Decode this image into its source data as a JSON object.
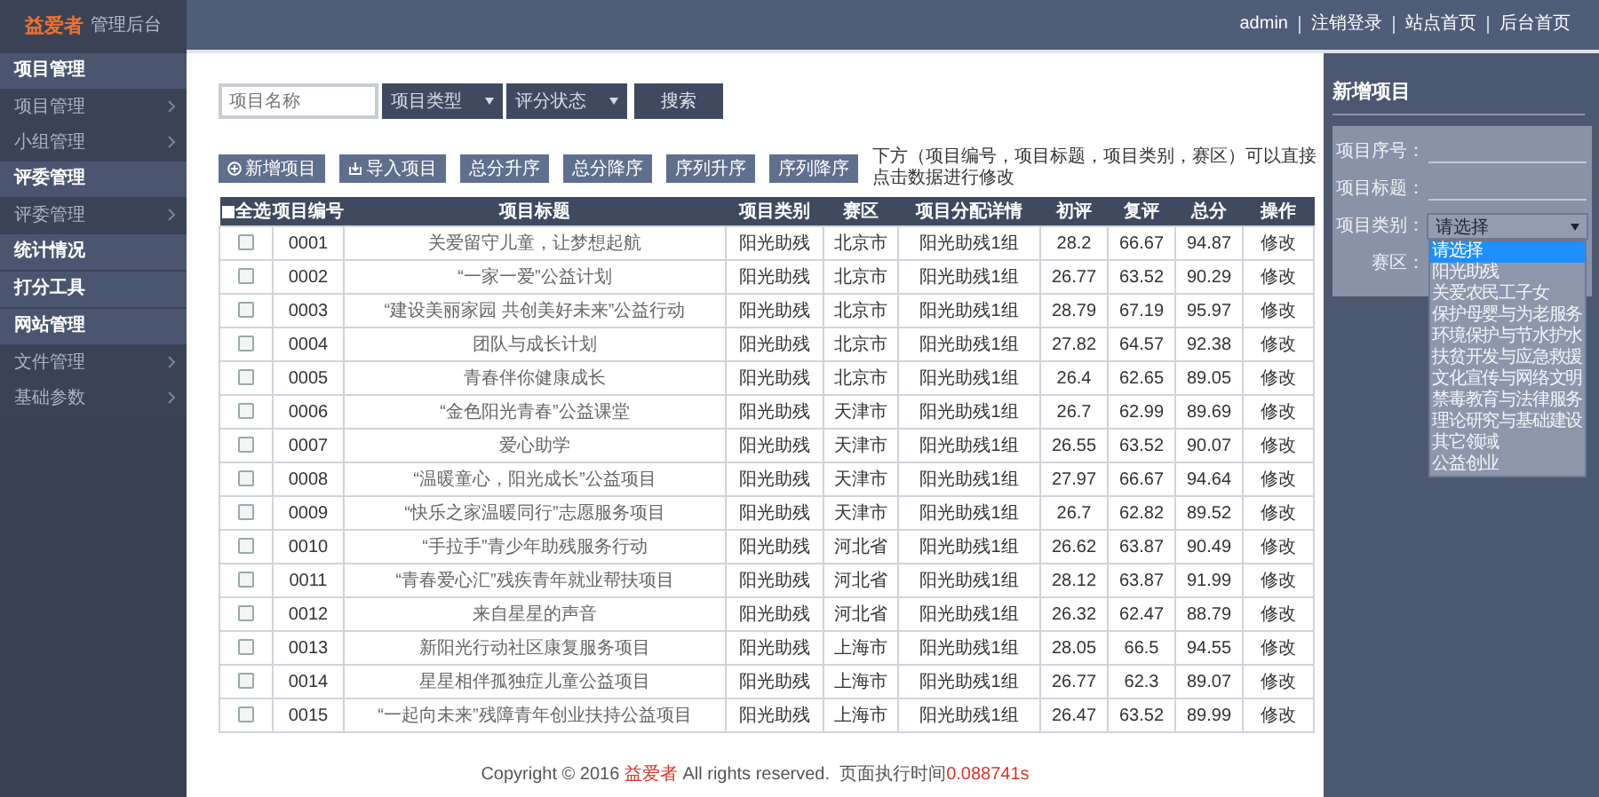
{
  "header": {
    "logo": "益爱者",
    "subtitle": "管理后台",
    "user": "admin",
    "links": [
      "注销登录",
      "站点首页",
      "后台首页"
    ]
  },
  "sidebar": [
    {
      "label": "项目管理",
      "kind": "group"
    },
    {
      "label": "项目管理",
      "kind": "item"
    },
    {
      "label": "小组管理",
      "kind": "item"
    },
    {
      "label": "评委管理",
      "kind": "group"
    },
    {
      "label": "评委管理",
      "kind": "item"
    },
    {
      "label": "统计情况",
      "kind": "group"
    },
    {
      "label": "打分工具",
      "kind": "group"
    },
    {
      "label": "网站管理",
      "kind": "group"
    },
    {
      "label": "文件管理",
      "kind": "item"
    },
    {
      "label": "基础参数",
      "kind": "item"
    }
  ],
  "filters": {
    "name_placeholder": "项目名称",
    "selects": [
      "项目类型",
      "评分状态"
    ],
    "search": "搜索"
  },
  "actions": [
    {
      "label": "新增项目",
      "kind": "add"
    },
    {
      "label": "导入项目",
      "kind": "import"
    },
    {
      "label": "总分升序",
      "kind": "plain"
    },
    {
      "label": "总分降序",
      "kind": "plain"
    },
    {
      "label": "序列升序",
      "kind": "plain"
    },
    {
      "label": "序列降序",
      "kind": "plain"
    }
  ],
  "note": "下方（项目编号，项目标题，项目类别，赛区）可以直接点击数据进行修改",
  "table": {
    "select_all": {
      "label": "全选",
      "checked": false
    },
    "columns": [
      "项目编号",
      "项目标题",
      "项目类别",
      "赛区",
      "项目分配详情",
      "初评",
      "复评",
      "总分",
      "操作"
    ],
    "rows": [
      {
        "checked": false,
        "cells": [
          "0001",
          "关爱留守儿童，让梦想起航",
          "阳光助残",
          "北京市",
          "阳光助残1组",
          "28.2",
          "66.67",
          "94.87",
          "修改"
        ]
      },
      {
        "checked": false,
        "cells": [
          "0002",
          "“一家一爱”公益计划",
          "阳光助残",
          "北京市",
          "阳光助残1组",
          "26.77",
          "63.52",
          "90.29",
          "修改"
        ]
      },
      {
        "checked": false,
        "cells": [
          "0003",
          "“建设美丽家园 共创美好未来”公益行动",
          "阳光助残",
          "北京市",
          "阳光助残1组",
          "28.79",
          "67.19",
          "95.97",
          "修改"
        ]
      },
      {
        "checked": false,
        "cells": [
          "0004",
          "团队与成长计划",
          "阳光助残",
          "北京市",
          "阳光助残1组",
          "27.82",
          "64.57",
          "92.38",
          "修改"
        ]
      },
      {
        "checked": false,
        "cells": [
          "0005",
          "青春伴你健康成长",
          "阳光助残",
          "北京市",
          "阳光助残1组",
          "26.4",
          "62.65",
          "89.05",
          "修改"
        ]
      },
      {
        "checked": false,
        "cells": [
          "0006",
          "“金色阳光青春”公益课堂",
          "阳光助残",
          "天津市",
          "阳光助残1组",
          "26.7",
          "62.99",
          "89.69",
          "修改"
        ]
      },
      {
        "checked": false,
        "cells": [
          "0007",
          "爱心助学",
          "阳光助残",
          "天津市",
          "阳光助残1组",
          "26.55",
          "63.52",
          "90.07",
          "修改"
        ]
      },
      {
        "checked": false,
        "cells": [
          "0008",
          "“温暖童心，阳光成长”公益项目",
          "阳光助残",
          "天津市",
          "阳光助残1组",
          "27.97",
          "66.67",
          "94.64",
          "修改"
        ]
      },
      {
        "checked": false,
        "cells": [
          "0009",
          "“快乐之家温暖同行”志愿服务项目",
          "阳光助残",
          "天津市",
          "阳光助残1组",
          "26.7",
          "62.82",
          "89.52",
          "修改"
        ]
      },
      {
        "checked": false,
        "cells": [
          "0010",
          "“手拉手”青少年助残服务行动",
          "阳光助残",
          "河北省",
          "阳光助残1组",
          "26.62",
          "63.87",
          "90.49",
          "修改"
        ]
      },
      {
        "checked": false,
        "cells": [
          "0011",
          "“青春爱心汇”残疾青年就业帮扶项目",
          "阳光助残",
          "河北省",
          "阳光助残1组",
          "28.12",
          "63.87",
          "91.99",
          "修改"
        ]
      },
      {
        "checked": false,
        "cells": [
          "0012",
          "来自星星的声音",
          "阳光助残",
          "河北省",
          "阳光助残1组",
          "26.32",
          "62.47",
          "88.79",
          "修改"
        ]
      },
      {
        "checked": false,
        "cells": [
          "0013",
          "新阳光行动社区康复服务项目",
          "阳光助残",
          "上海市",
          "阳光助残1组",
          "28.05",
          "66.5",
          "94.55",
          "修改"
        ]
      },
      {
        "checked": false,
        "cells": [
          "0014",
          "星星相伴孤独症儿童公益项目",
          "阳光助残",
          "上海市",
          "阳光助残1组",
          "26.77",
          "62.3",
          "89.07",
          "修改"
        ]
      },
      {
        "checked": false,
        "cells": [
          "0015",
          "“一起向未来”残障青年创业扶持公益项目",
          "阳光助残",
          "上海市",
          "阳光助残1组",
          "26.47",
          "63.52",
          "89.99",
          "修改"
        ]
      }
    ]
  },
  "form": {
    "title": "新增项目",
    "fields": [
      {
        "label": "项目序号：",
        "kind": "text"
      },
      {
        "label": "项目标题：",
        "kind": "text"
      },
      {
        "label": "项目类别：",
        "kind": "select",
        "value": "请选择",
        "expanded": true
      },
      {
        "label": "赛区：",
        "kind": "text"
      }
    ],
    "options": [
      {
        "label": "请选择",
        "selected": true
      },
      {
        "label": "阳光助残",
        "selected": false
      },
      {
        "label": "关爱农民工子女",
        "selected": false
      },
      {
        "label": "保护母婴与为老服务",
        "selected": false
      },
      {
        "label": "环境保护与节水护水",
        "selected": false
      },
      {
        "label": "扶贫开发与应急救援",
        "selected": false
      },
      {
        "label": "文化宣传与网络文明",
        "selected": false
      },
      {
        "label": "禁毒教育与法律服务",
        "selected": false
      },
      {
        "label": "理论研究与基础建设",
        "selected": false
      },
      {
        "label": "其它领域",
        "selected": false
      },
      {
        "label": "公益创业",
        "selected": false
      }
    ]
  },
  "footer": [
    {
      "text": "Copyright © 2016 ",
      "kind": "plain"
    },
    {
      "text": "益爱者",
      "kind": "accent"
    },
    {
      "text": " All rights reserved.  页面执行时间",
      "kind": "plain"
    },
    {
      "text": "0.088741s",
      "kind": "accent"
    }
  ]
}
